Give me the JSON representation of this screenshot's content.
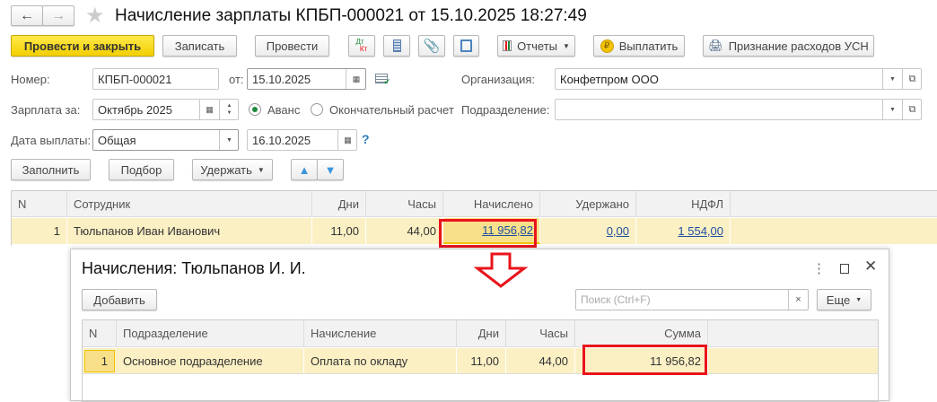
{
  "window": {
    "title": "Начисление зарплаты КПБП-000021 от 15.10.2025 18:27:49"
  },
  "toolbar": {
    "post_close": "Провести и закрыть",
    "save": "Записать",
    "post": "Провести",
    "dt": "Дт",
    "kt": "Кт",
    "reports": "Отчеты",
    "pay": "Выплатить",
    "usn": "Признание расходов УСН"
  },
  "form": {
    "number_label": "Номер:",
    "number": "КПБП-000021",
    "from_label": "от:",
    "date": "15.10.2025",
    "org_label": "Организация:",
    "org": "Конфетпром ООО",
    "salary_for_label": "Зарплата за:",
    "salary_for": "Октябрь 2025",
    "radio_advance": "Аванс",
    "radio_final": "Окончательный расчет",
    "advance_selected": true,
    "dept_label": "Подразделение:",
    "dept": "",
    "pay_date_label": "Дата выплаты:",
    "pay_date_type": "Общая",
    "pay_date": "16.10.2025",
    "help": "?"
  },
  "actions": {
    "fill": "Заполнить",
    "select": "Подбор",
    "withhold": "Удержать"
  },
  "table": {
    "headers": [
      "N",
      "Сотрудник",
      "Дни",
      "Часы",
      "Начислено",
      "Удержано",
      "НДФЛ"
    ],
    "rows": [
      {
        "n": "1",
        "employee": "Тюльпанов Иван Иванович",
        "days": "11,00",
        "hours": "44,00",
        "accrued": "11 956,82",
        "withheld": "0,00",
        "ndfl": "1 554,00"
      }
    ]
  },
  "dialog": {
    "title": "Начисления: Тюльпанов И. И.",
    "add": "Добавить",
    "search_placeholder": "Поиск (Ctrl+F)",
    "clear": "×",
    "more": "Еще",
    "headers": [
      "N",
      "Подразделение",
      "Начисление",
      "Дни",
      "Часы",
      "Сумма"
    ],
    "rows": [
      {
        "n": "1",
        "dept": "Основное подразделение",
        "accrual": "Оплата по окладу",
        "days": "11,00",
        "hours": "44,00",
        "sum": "11 956,82"
      }
    ]
  },
  "colors": {
    "accent_yellow": "#f2cf00",
    "highlight_red": "#e8141c",
    "row_selected": "#fbf0c4",
    "link": "#1f4fa0"
  }
}
